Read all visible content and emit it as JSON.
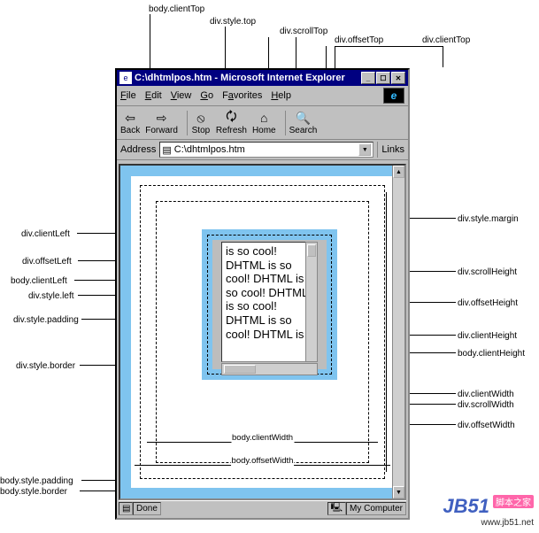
{
  "top_labels": {
    "body_clientTop": "body.clientTop",
    "div_style_top": "div.style.top",
    "div_scrollTop": "div.scrollTop",
    "div_offsetTop": "div.offsetTop",
    "div_clientTop": "div.clientTop"
  },
  "left_labels": {
    "div_clientLeft": "div.clientLeft",
    "div_offsetLeft": "div.offsetLeft",
    "body_clientLeft": "body.clientLeft",
    "div_style_left": "div.style.left",
    "div_style_padding": "div.style.padding",
    "div_style_border": "div.style.border",
    "body_style_padding": "body.style.padding",
    "body_style_border": "body.style.border"
  },
  "right_labels": {
    "div_style_margin": "div.style.margin",
    "div_scrollHeight": "div.scrollHeight",
    "div_offsetHeight": "div.offsetHeight",
    "div_clientHeight": "div.clientHeight",
    "body_clientHeight": "body.clientHeight",
    "div_clientWidth": "div.clientWidth",
    "div_scrollWidth": "div.scrollWidth",
    "div_offsetWidth": "div.offsetWidth"
  },
  "inside_labels": {
    "body_clientWidth": "body.clientWidth",
    "body_offsetWidth": "body.offsetWidth"
  },
  "window": {
    "title": "C:\\dhtmlpos.htm - Microsoft Internet Explorer",
    "btn_min": "_",
    "btn_max": "☐",
    "btn_close": "✕"
  },
  "menu": {
    "File": "File",
    "Edit": "Edit",
    "View": "View",
    "Go": "Go",
    "Favorites": "Favorites",
    "Help": "Help"
  },
  "toolbar": {
    "Back": "Back",
    "Forward": "Forward",
    "Stop": "Stop",
    "Refresh": "Refresh",
    "Home": "Home",
    "Search": "Search"
  },
  "address": {
    "label": "Address",
    "value": "C:\\dhtmlpos.htm",
    "links": "Links"
  },
  "content": {
    "text": "is so cool! DHTML is so cool! DHTML is so cool! DHTML is so cool! DHTML is so cool! DHTML is"
  },
  "status": {
    "done": "Done",
    "zone": "My Computer"
  },
  "watermark": {
    "logo": "JB51",
    "tag": "脚本之家",
    "url": "www.jb51.net"
  }
}
